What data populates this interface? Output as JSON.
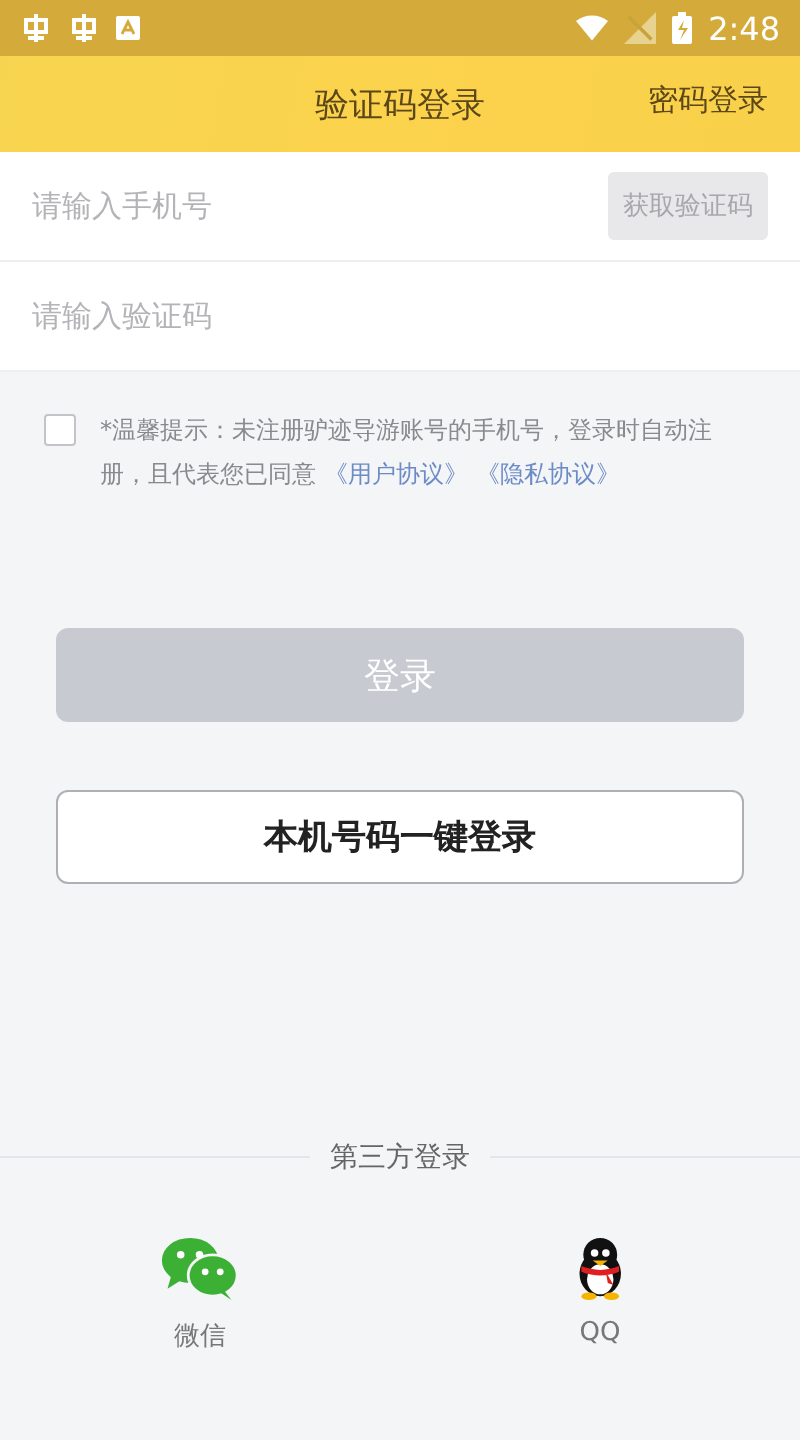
{
  "status_bar": {
    "time": "2:48"
  },
  "header": {
    "title": "验证码登录",
    "action": "密码登录"
  },
  "form": {
    "phone": {
      "placeholder": "请输入手机号"
    },
    "code_button": {
      "label": "获取验证码",
      "disabled": true
    },
    "code": {
      "placeholder": "请输入验证码"
    }
  },
  "agreement": {
    "checked": false,
    "text": "*温馨提示：未注册驴迹导游账号的手机号，登录时自动注册，且代表您已同意",
    "links": [
      "《用户协议》",
      "《隐私协议》"
    ]
  },
  "login_button": {
    "label": "登录",
    "disabled": true
  },
  "one_click_button": {
    "label": "本机号码一键登录"
  },
  "third_party": {
    "title": "第三方登录",
    "options": [
      {
        "kind": "wechat",
        "label": "微信"
      },
      {
        "kind": "qq",
        "label": "QQ"
      }
    ]
  }
}
